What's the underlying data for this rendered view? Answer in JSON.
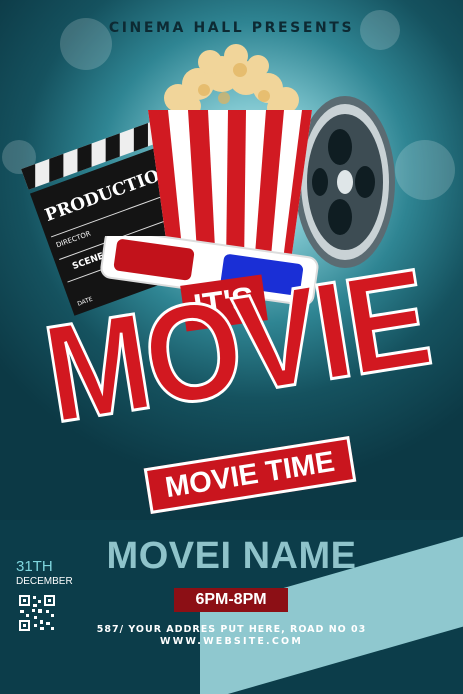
{
  "headline": "CINEMA HALL PRESENTS",
  "clapper": {
    "production": "PRODUCTION",
    "director": "DIRECTOR",
    "scene": "SCENE",
    "date": "DATE"
  },
  "title": {
    "tag": "IT'S",
    "main": "MOVIE",
    "subtitle": "MOVIE TIME"
  },
  "movie_name": "MOVEI NAME",
  "time": "6PM-8PM",
  "date": {
    "day": "31TH",
    "month": "DECEMBER"
  },
  "address": "587/ YOUR ADDRES PUT HERE, ROAD NO 03",
  "website": "WWW.WEBSITE.COM",
  "colors": {
    "accent_red": "#c9151e",
    "teal_dark": "#0c3d4a",
    "teal_light": "#8fc3ca"
  },
  "icons": [
    "clapperboard-icon",
    "popcorn-icon",
    "film-reel-icon",
    "3d-glasses-icon",
    "qr-code-icon"
  ]
}
